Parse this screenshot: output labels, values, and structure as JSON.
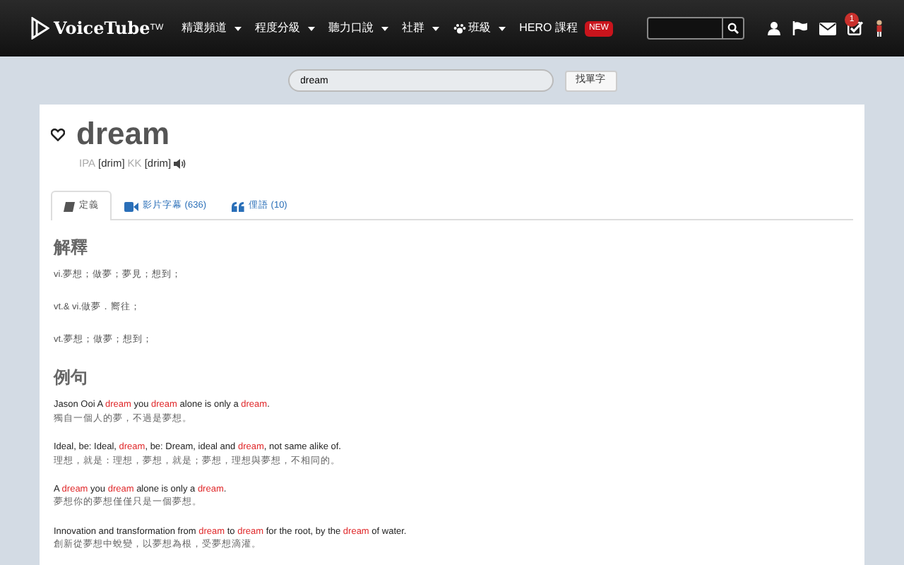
{
  "navbar": {
    "logo": "VoiceTube",
    "logo_sup": "TW",
    "menu": [
      {
        "label": "精選頻道",
        "dropdown": true,
        "icon": false
      },
      {
        "label": "程度分級",
        "dropdown": true,
        "icon": false
      },
      {
        "label": "聽力口說",
        "dropdown": true,
        "icon": false
      },
      {
        "label": "社群",
        "dropdown": true,
        "icon": false
      },
      {
        "label": "班級",
        "dropdown": true,
        "icon": true
      },
      {
        "label": "HERO 課程",
        "dropdown": false,
        "icon": false,
        "badge": "NEW"
      }
    ],
    "notification_count": "1"
  },
  "search": {
    "value": "dream",
    "button": "找單字"
  },
  "word": {
    "title": "dream",
    "favorite": false,
    "ipa_label": "IPA",
    "ipa": "[drim]",
    "kk_label": "KK",
    "kk": "[drim]"
  },
  "tabs": [
    {
      "label": "定義",
      "kind": "book",
      "selected": true
    },
    {
      "label": "影片字幕 (636)",
      "kind": "video",
      "selected": false
    },
    {
      "label": "俚語 (10)",
      "kind": "quote",
      "selected": false
    }
  ],
  "definitions": {
    "heading": "解釋",
    "items": [
      "vi.夢想；做夢；夢見；想到；",
      "vt.& vi.做夢．嚮往；",
      "vt.夢想；做夢；想到；"
    ]
  },
  "examples": {
    "heading": "例句",
    "items": [
      {
        "english": [
          {
            "text": "Jason Ooi A ",
            "highlight": false
          },
          {
            "text": "dream",
            "highlight": true
          },
          {
            "text": " you ",
            "highlight": false
          },
          {
            "text": "dream",
            "highlight": true
          },
          {
            "text": " alone is only a ",
            "highlight": false
          },
          {
            "text": "dream",
            "highlight": true
          },
          {
            "text": ".",
            "highlight": false
          }
        ],
        "chinese": "獨自一個人的夢，不過是夢想。"
      },
      {
        "english": [
          {
            "text": "Ideal, be: Ideal, ",
            "highlight": false
          },
          {
            "text": "dream",
            "highlight": true
          },
          {
            "text": ", be: Dream, ideal and ",
            "highlight": false
          },
          {
            "text": "dream",
            "highlight": true
          },
          {
            "text": ", not same alike of.",
            "highlight": false
          }
        ],
        "chinese": "理想，就是：理想，夢想，就是；夢想，理想與夢想，不相同的。"
      },
      {
        "english": [
          {
            "text": "A ",
            "highlight": false
          },
          {
            "text": "dream",
            "highlight": true
          },
          {
            "text": " you ",
            "highlight": false
          },
          {
            "text": "dream",
            "highlight": true
          },
          {
            "text": " alone is only a ",
            "highlight": false
          },
          {
            "text": "dream",
            "highlight": true
          },
          {
            "text": ".",
            "highlight": false
          }
        ],
        "chinese": "夢想你的夢想僅僅只是一個夢想。"
      },
      {
        "english": [
          {
            "text": "Innovation and transformation from ",
            "highlight": false
          },
          {
            "text": "dream",
            "highlight": true
          },
          {
            "text": " to ",
            "highlight": false
          },
          {
            "text": "dream",
            "highlight": true
          },
          {
            "text": " for the root, by the ",
            "highlight": false
          },
          {
            "text": "dream",
            "highlight": true
          },
          {
            "text": " of water.",
            "highlight": false
          }
        ],
        "chinese": "創新從夢想中蛻變，以夢想為根，受夢想滴灌。"
      }
    ]
  }
}
